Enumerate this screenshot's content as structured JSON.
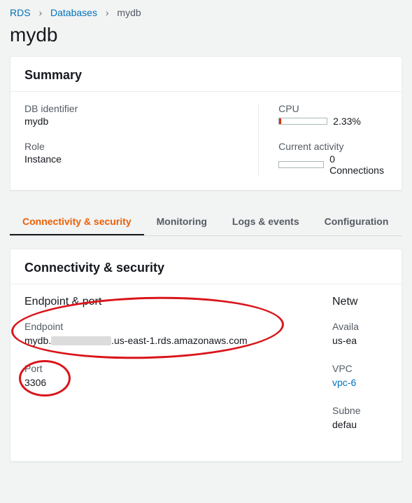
{
  "breadcrumb": {
    "root": "RDS",
    "level1": "Databases",
    "current": "mydb"
  },
  "page_title": "mydb",
  "summary": {
    "heading": "Summary",
    "db_identifier_label": "DB identifier",
    "db_identifier_value": "mydb",
    "role_label": "Role",
    "role_value": "Instance",
    "cpu_label": "CPU",
    "cpu_value": "2.33%",
    "activity_label": "Current activity",
    "activity_value": "0 Connections"
  },
  "tabs": {
    "connectivity": "Connectivity & security",
    "monitoring": "Monitoring",
    "logs": "Logs & events",
    "configuration": "Configuration"
  },
  "conn_security": {
    "heading": "Connectivity & security",
    "section_heading": "Endpoint & port",
    "endpoint_label": "Endpoint",
    "endpoint_prefix": "mydb.",
    "endpoint_suffix": ".us-east-1.rds.amazonaws.com",
    "port_label": "Port",
    "port_value": "3306",
    "networking_heading": "Netw",
    "az_label": "Availa",
    "az_value": "us-ea",
    "vpc_label": "VPC",
    "vpc_value": "vpc-6",
    "subnet_label": "Subne",
    "subnet_value": "defau"
  }
}
